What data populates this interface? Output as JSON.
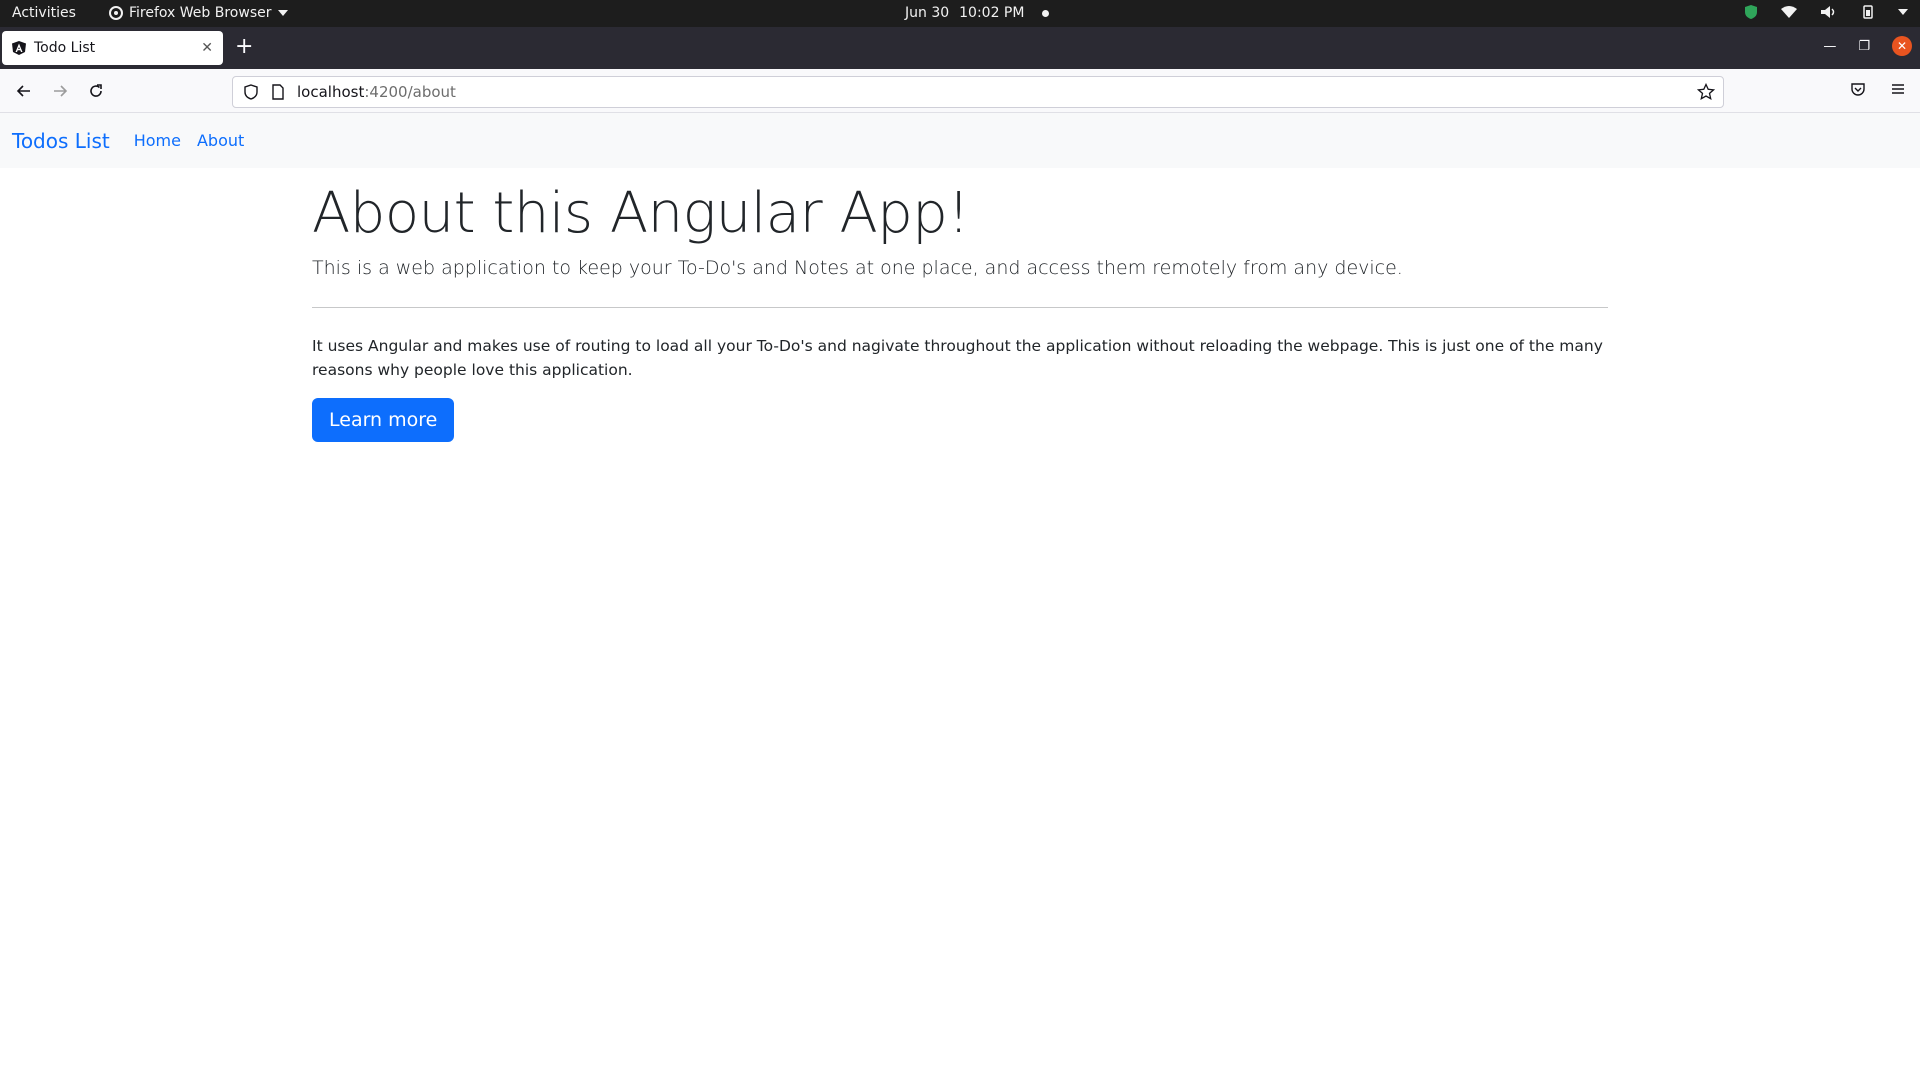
{
  "system_bar": {
    "activities": "Activities",
    "app_name": "Firefox Web Browser",
    "date": "Jun 30",
    "time": "10:02 PM"
  },
  "browser": {
    "tab_title": "Todo List",
    "url_host": "localhost",
    "url_path": ":4200/about"
  },
  "site_nav": {
    "brand": "Todos List",
    "links": [
      "Home",
      "About"
    ]
  },
  "main": {
    "heading": "About this Angular App!",
    "lead": "This is a web application to keep your To-Do's and Notes at one place, and access them remotely from any device.",
    "body": "It uses Angular and makes use of routing to load all your To-Do's and nagivate throughout the application without reloading the webpage. This is just one of the many reasons why people love this application.",
    "button_label": "Learn more"
  },
  "colors": {
    "primary": "#0d6efd",
    "navbar_bg": "#f8f9fa",
    "ubuntu_close": "#e95420"
  }
}
